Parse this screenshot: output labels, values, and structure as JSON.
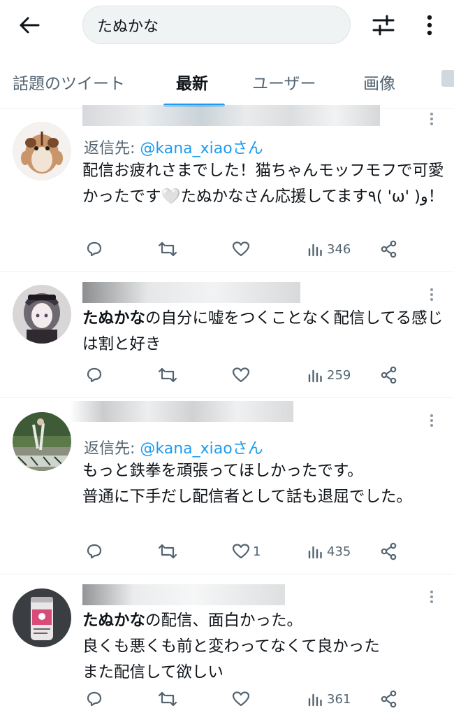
{
  "search": {
    "query": "たぬかな"
  },
  "tabs": [
    {
      "label": "話題のツイート"
    },
    {
      "label": "最新"
    },
    {
      "label": "ユーザー"
    },
    {
      "label": "画像"
    }
  ],
  "tweets": [
    {
      "reply_prefix": "返信先: ",
      "reply_handle": "@kana_xiaoさん",
      "text": "配信お疲れさまでした！猫ちゃんモッフモフで可愛かったです🤍たぬかなさん応援してます٩( 'ω' )و！",
      "views": "346",
      "likes": ""
    },
    {
      "mention": "たぬかな",
      "text_rest": "の自分に嘘をつくことなく配信してる感じは割と好き",
      "views": "259",
      "likes": ""
    },
    {
      "reply_prefix": "返信先: ",
      "reply_handle": "@kana_xiaoさん",
      "line1": "もっと鉄拳を頑張ってほしかったです。",
      "line2": "普通に下手だし配信者として話も退屈でした。",
      "views": "435",
      "likes": "1"
    },
    {
      "mention": "たぬかな",
      "line1_rest": "の配信、面白かった。",
      "line2": "良くも悪くも前と変わってなくて良かった",
      "line3": "また配信して欲しい",
      "views": "361",
      "likes": ""
    }
  ],
  "colors": {
    "accent": "#1d9bf0",
    "text_primary": "#0f1419",
    "text_secondary": "#536471"
  }
}
